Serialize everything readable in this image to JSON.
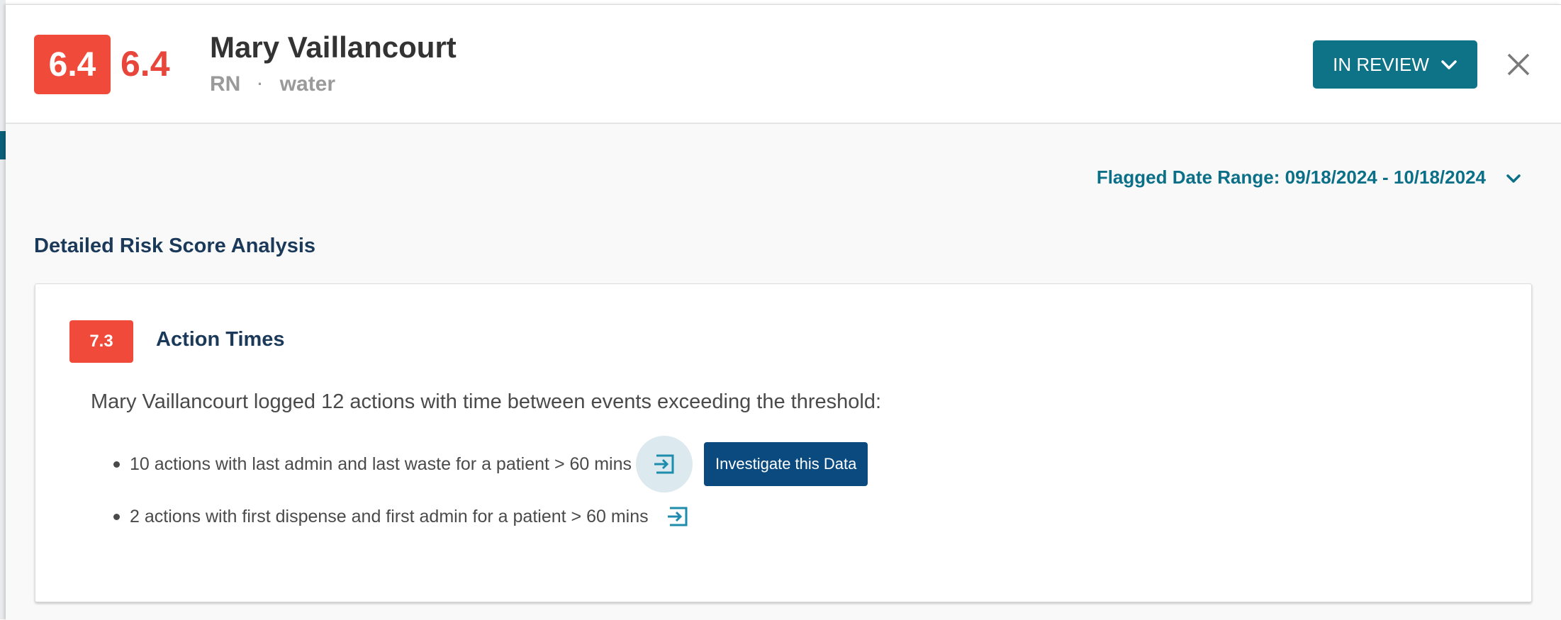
{
  "header": {
    "score_badge": "6.4",
    "score_text": "6.4",
    "name": "Mary Vaillancourt",
    "role": "RN",
    "separator": "·",
    "substance": "water",
    "status_label": "IN REVIEW",
    "icons": {
      "status_dropdown": "chevron-down-icon",
      "close": "close-icon"
    }
  },
  "date_range": {
    "label": "Flagged Date Range: 09/18/2024 - 10/18/2024",
    "icon": "chevron-down-icon"
  },
  "analysis": {
    "title": "Detailed Risk Score Analysis",
    "card": {
      "score": "7.3",
      "title": "Action Times",
      "summary": "Mary Vaillancourt logged 12 actions with time between events exceeding the threshold:",
      "items": [
        {
          "text": "10 actions with last admin and last waste for a patient > 60 mins",
          "icon": "open-in-icon"
        },
        {
          "text": "2 actions with first dispense and first admin for a patient > 60 mins",
          "icon": "open-in-icon"
        }
      ],
      "tooltip_button": "Investigate this Data"
    }
  },
  "colors": {
    "risk_red": "#f04a3a",
    "teal": "#0e7387",
    "navy": "#0a4a7f",
    "title_navy": "#1b3a5a"
  }
}
